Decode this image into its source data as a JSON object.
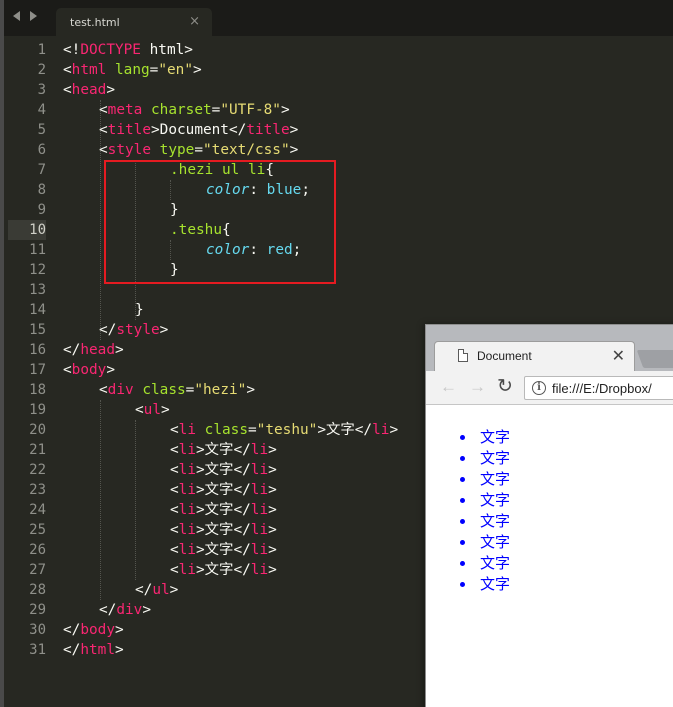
{
  "editor": {
    "tab_title": "test.html",
    "tab_close": "×",
    "line_numbers": [
      "1",
      "2",
      "3",
      "4",
      "5",
      "6",
      "7",
      "8",
      "9",
      "10",
      "11",
      "12",
      "13",
      "14",
      "15",
      "16",
      "17",
      "18",
      "19",
      "20",
      "21",
      "22",
      "23",
      "24",
      "25",
      "26",
      "27",
      "28",
      "29",
      "30",
      "31"
    ],
    "active_line": "10",
    "code": {
      "l1": [
        "<!",
        "DOCTYPE",
        " html>"
      ],
      "l2": [
        "<",
        "html",
        " ",
        "lang",
        "=",
        "\"en\"",
        ">"
      ],
      "l3": [
        "<",
        "head",
        ">"
      ],
      "l4": [
        "<",
        "meta",
        " ",
        "charset",
        "=",
        "\"UTF-8\"",
        ">"
      ],
      "l5": [
        "<",
        "title",
        ">Document</",
        "title",
        ">"
      ],
      "l6": [
        "<",
        "style",
        " ",
        "type",
        "=",
        "\"text/css\"",
        ">"
      ],
      "l7": [
        ".hezi ul li",
        "{"
      ],
      "l8": [
        "color",
        ": ",
        "blue",
        ";"
      ],
      "l9": [
        "}"
      ],
      "l10": [
        ".teshu",
        "{"
      ],
      "l11": [
        "color",
        ": ",
        "red",
        ";"
      ],
      "l12": [
        "}"
      ],
      "l14": [
        "}"
      ],
      "l15": [
        "</",
        "style",
        ">"
      ],
      "l16": [
        "</",
        "head",
        ">"
      ],
      "l17": [
        "<",
        "body",
        ">"
      ],
      "l18": [
        "<",
        "div",
        " ",
        "class",
        "=",
        "\"hezi\"",
        ">"
      ],
      "l19": [
        "<",
        "ul",
        ">"
      ],
      "l20": [
        "<",
        "li",
        " ",
        "class",
        "=",
        "\"teshu\"",
        ">文字</",
        "li",
        ">"
      ],
      "li_line": [
        "<",
        "li",
        ">文字</",
        "li",
        ">"
      ],
      "l28": [
        "</",
        "ul",
        ">"
      ],
      "l29": [
        "</",
        "div",
        ">"
      ],
      "l30": [
        "</",
        "body",
        ">"
      ],
      "l31": [
        "</",
        "html",
        ">"
      ]
    }
  },
  "browser": {
    "tab_title": "Document",
    "tab_close": "✕",
    "url": "file:///E:/Dropbox/",
    "nav": {
      "back": "←",
      "forward": "→",
      "reload": "↻",
      "info": "i"
    },
    "list_items": [
      "文字",
      "文字",
      "文字",
      "文字",
      "文字",
      "文字",
      "文字",
      "文字"
    ],
    "link_color": "#0000ff"
  },
  "colors": {
    "editor_bg": "#272822",
    "tag": "#f92672",
    "attr": "#a6e22e",
    "string": "#e6db74",
    "property": "#66d9ef",
    "highlight_box": "#e51b21"
  }
}
